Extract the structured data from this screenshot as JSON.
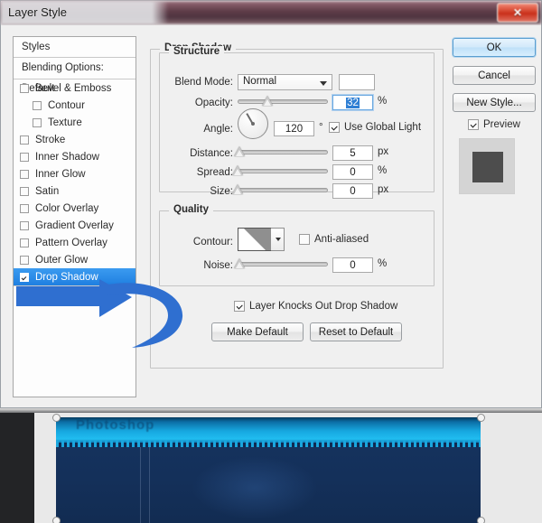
{
  "window": {
    "title": "Layer Style",
    "close_label": "✕"
  },
  "styles_list": {
    "header": "Styles",
    "blending_options": "Blending Options: Default",
    "items": [
      {
        "label": "Bevel & Emboss",
        "checked": false,
        "indent": false,
        "selected": false
      },
      {
        "label": "Contour",
        "checked": false,
        "indent": true,
        "selected": false
      },
      {
        "label": "Texture",
        "checked": false,
        "indent": true,
        "selected": false
      },
      {
        "label": "Stroke",
        "checked": false,
        "indent": false,
        "selected": false
      },
      {
        "label": "Inner Shadow",
        "checked": false,
        "indent": false,
        "selected": false
      },
      {
        "label": "Inner Glow",
        "checked": false,
        "indent": false,
        "selected": false
      },
      {
        "label": "Satin",
        "checked": false,
        "indent": false,
        "selected": false
      },
      {
        "label": "Color Overlay",
        "checked": false,
        "indent": false,
        "selected": false
      },
      {
        "label": "Gradient Overlay",
        "checked": false,
        "indent": false,
        "selected": false
      },
      {
        "label": "Pattern Overlay",
        "checked": false,
        "indent": false,
        "selected": false
      },
      {
        "label": "Outer Glow",
        "checked": false,
        "indent": false,
        "selected": false
      },
      {
        "label": "Drop Shadow",
        "checked": true,
        "indent": false,
        "selected": true
      }
    ]
  },
  "drop_shadow": {
    "group_title": "Drop Shadow",
    "structure": {
      "legend": "Structure",
      "blend_mode_label": "Blend Mode:",
      "blend_mode_value": "Normal",
      "blend_mode_color": "#ffffff",
      "opacity_label": "Opacity:",
      "opacity_value": "32",
      "opacity_unit": "%",
      "opacity_slider_pct": 33,
      "angle_label": "Angle:",
      "angle_value": "120",
      "angle_unit": "°",
      "angle_degrees": 120,
      "use_global_light_label": "Use Global Light",
      "use_global_light_checked": true,
      "distance_label": "Distance:",
      "distance_value": "5",
      "distance_unit": "px",
      "distance_slider_pct": 2,
      "spread_label": "Spread:",
      "spread_value": "0",
      "spread_unit": "%",
      "spread_slider_pct": 0,
      "size_label": "Size:",
      "size_value": "0",
      "size_unit": "px",
      "size_slider_pct": 0
    },
    "quality": {
      "legend": "Quality",
      "contour_label": "Contour:",
      "anti_aliased_label": "Anti-aliased",
      "anti_aliased_checked": false,
      "noise_label": "Noise:",
      "noise_value": "0",
      "noise_unit": "%",
      "noise_slider_pct": 2
    },
    "knockout_label": "Layer Knocks Out Drop Shadow",
    "knockout_checked": true,
    "make_default_label": "Make Default",
    "reset_default_label": "Reset to Default"
  },
  "actions": {
    "ok_label": "OK",
    "cancel_label": "Cancel",
    "new_style_label": "New Style...",
    "preview_label": "Preview",
    "preview_checked": true
  },
  "background": {
    "banner_text": "Photoshop"
  },
  "annotation": {
    "arrow_color": "#2f6fd0",
    "arrow_meaning": "curved-back-arrow pointing at Drop Shadow"
  },
  "colors": {
    "accent_blue": "#2f7fd4",
    "selection_blue": "#1f7fe0",
    "close_red": "#c9301b",
    "banner_cyan": "#20bdf0",
    "banner_navy": "#122c52"
  }
}
